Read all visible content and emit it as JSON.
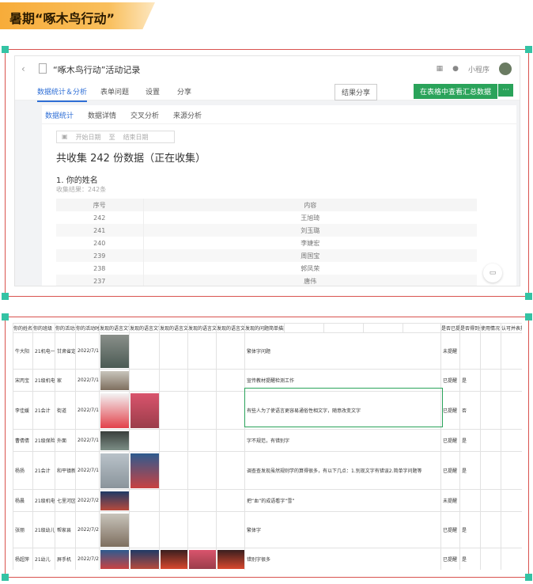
{
  "banner": {
    "title": "暑期“啄木鸟行动”"
  },
  "shot1": {
    "header": {
      "back": "‹",
      "title": "“啄木鸟行动”活动记录",
      "mini_program": "小程序"
    },
    "tabs": [
      "数据统计＆分析",
      "表单问题",
      "设置",
      "分享"
    ],
    "share_button": "结果分享",
    "view_table_button": "在表格中查看汇总数据",
    "more_button": "···",
    "subtabs": [
      "数据统计",
      "数据详情",
      "交叉分析",
      "来源分析"
    ],
    "date_range": {
      "start": "开始日期",
      "sep": "至",
      "end": "结束日期"
    },
    "count_text": "共收集 242 份数据（正在收集）",
    "question": "1. 你的姓名",
    "question_sub": "收集结果：242条",
    "table": {
      "headers": [
        "序号",
        "内容"
      ],
      "rows": [
        [
          "242",
          "王旭琦"
        ],
        [
          "241",
          "刘玉璐"
        ],
        [
          "240",
          "李婕宏"
        ],
        [
          "239",
          "周国宝"
        ],
        [
          "238",
          "郭凤荣"
        ],
        [
          "237",
          "唐伟"
        ]
      ]
    }
  },
  "shot2": {
    "headers": [
      "你的姓名",
      "你的班级",
      "你的活动地",
      "你的活动时间",
      "发现的语言文字",
      "发现的语言文字",
      "发现的语言文字",
      "发现的语言文字",
      "发现的语言文字",
      "发现的问题简单描述",
      "",
      "",
      "",
      "",
      "是否已提醒",
      "是否得到处理",
      "使用情况",
      "认可并表扬"
    ],
    "rows": [
      {
        "name": "牛大阳",
        "class": "21机电一班",
        "place": "甘肃省定西",
        "date": "2022/7/16",
        "desc": "繁体字问题",
        "reminded": "未提醒",
        "handled": ""
      },
      {
        "name": "宋丙宝",
        "class": "21级机电一班",
        "place": "家",
        "date": "2022/7/17",
        "desc": "宣传教材提醒检测工作",
        "reminded": "已提醒",
        "handled": "是"
      },
      {
        "name": "李佳媛",
        "class": "21会计",
        "place": "街道",
        "date": "2022/7/17",
        "desc": "有些人为了使语言更容易通俗性相文字，随意改变文字",
        "reminded": "已提醒",
        "handled": "否"
      },
      {
        "name": "曹倩倩",
        "class": "21级保险",
        "place": "外面",
        "date": "2022/7/16",
        "desc": "字不规范，有错别字",
        "reminded": "已提醒",
        "handled": "是"
      },
      {
        "name": "杨扬",
        "class": "21会计",
        "place": "和平镇新街",
        "date": "2022/7/18",
        "desc": "调查查发现虽然规则学的算得很多，有以下几点：1.别现文字有错误2.简单字问题等",
        "reminded": "已提醒",
        "handled": "是"
      },
      {
        "name": "杨晨",
        "class": "21级机电",
        "place": "七里河区",
        "date": "2022/7/20",
        "desc": "把“血”的成语看字“雪”",
        "reminded": "未提醒",
        "handled": ""
      },
      {
        "name": "张丽",
        "class": "21级幼儿",
        "place": "帮家县",
        "date": "2022/7/25",
        "desc": "繁体字",
        "reminded": "已提醒",
        "handled": "是"
      },
      {
        "name": "杨超萍",
        "class": "21幼儿",
        "place": "屏手机",
        "date": "2022/7/25",
        "desc": "错别字很多",
        "reminded": "已提醒",
        "handled": "是"
      }
    ]
  }
}
